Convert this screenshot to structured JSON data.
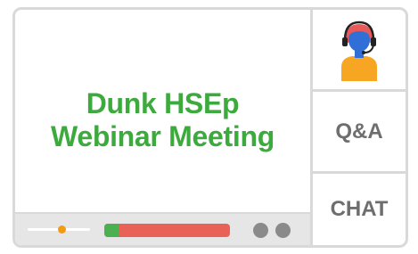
{
  "meeting": {
    "title_line1": "Dunk HSEp",
    "title_line2": "Webinar Meeting"
  },
  "controls": {
    "volume_level": 0.55,
    "progress_level": 0.12,
    "colors": {
      "volume_knob": "#f39c12",
      "progress_fill": "#4caf50",
      "progress_remaining": "#e96257",
      "dots": "#8a8a8a"
    }
  },
  "sidebar": {
    "avatar_icon": "presenter-headset-avatar-icon",
    "qa_label": "Q&A",
    "chat_label": "CHAT"
  },
  "colors": {
    "title_green": "#3daa3d",
    "avatar_face_blue": "#2f6fd6",
    "avatar_hair_red": "#e85a5a",
    "avatar_body_orange": "#f6a623"
  }
}
